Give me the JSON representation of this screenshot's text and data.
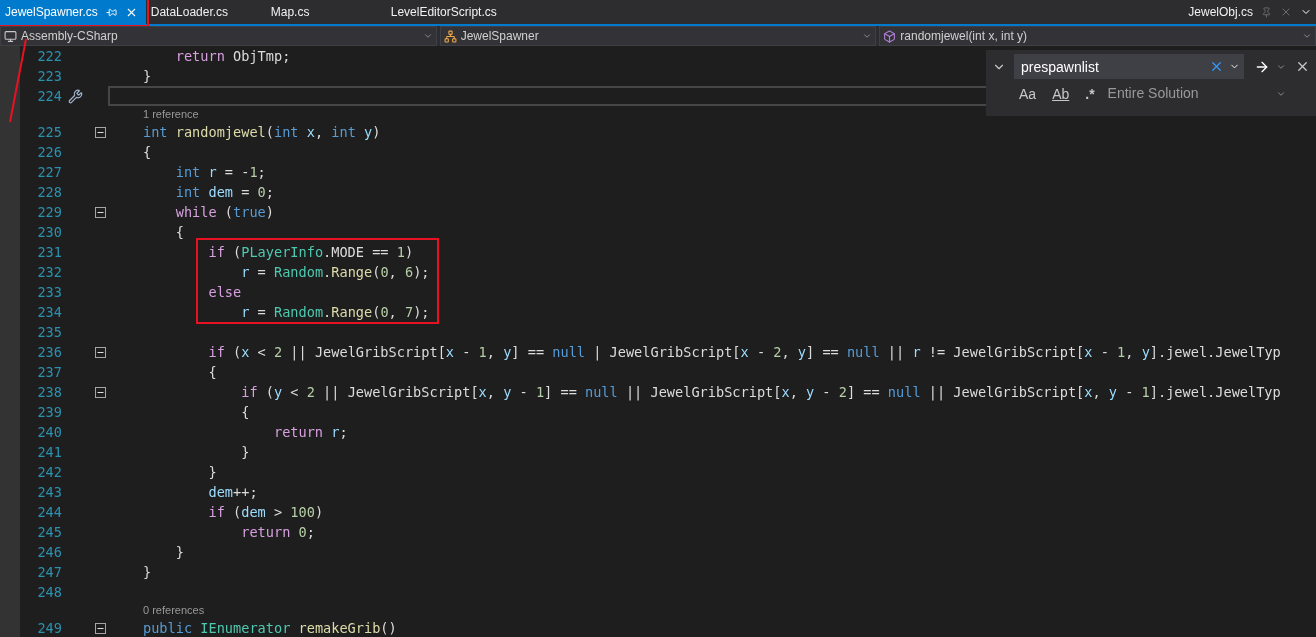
{
  "tabs": [
    {
      "label": "JewelSpawner.cs",
      "selected": true,
      "highlighted": true,
      "pinned": true
    },
    {
      "label": "DataLoader.cs",
      "selected": false,
      "highlighted": false,
      "pinned": false
    },
    {
      "label": "Map.cs",
      "selected": false,
      "highlighted": false,
      "pinned": false
    },
    {
      "label": "LevelEditorScript.cs",
      "selected": false,
      "highlighted": false,
      "pinned": false
    }
  ],
  "preview_tab": {
    "label": "JewelObj.cs"
  },
  "navigation": [
    {
      "kind": "project",
      "label": "Assembly-CSharp"
    },
    {
      "kind": "class",
      "label": "JewelSpawner"
    },
    {
      "kind": "method",
      "label": "randomjewel(int x, int y)"
    }
  ],
  "find": {
    "value": "prespawnlist",
    "options": [
      {
        "label": "Aa",
        "selected": false
      },
      {
        "label": "Ab",
        "selected": false
      },
      {
        "label": ".*",
        "selected": false
      }
    ],
    "scope": "Entire Solution"
  },
  "lines": [
    {
      "kind": "code",
      "number": "222",
      "foldable": false,
      "current": false,
      "highlighted": false,
      "tokens": [
        {
          "kind": "control",
          "text": "    return"
        },
        {
          "kind": "plain",
          "text": " ObjTmp;"
        }
      ]
    },
    {
      "kind": "code",
      "number": "223",
      "foldable": false,
      "current": false,
      "highlighted": false,
      "tokens": [
        {
          "kind": "plain",
          "text": "}"
        }
      ]
    },
    {
      "kind": "code",
      "number": "224",
      "foldable": false,
      "current": true,
      "highlighted": false
    },
    {
      "kind": "lens",
      "text": "1 reference"
    },
    {
      "kind": "code",
      "number": "225",
      "foldable": true,
      "current": false,
      "highlighted": false,
      "tokens": [
        {
          "kind": "keyword",
          "text": "int"
        },
        {
          "kind": "method",
          "text": " randomjewel"
        },
        {
          "kind": "plain",
          "text": "("
        },
        {
          "kind": "keyword",
          "text": "int"
        },
        {
          "kind": "variable",
          "text": " x"
        },
        {
          "kind": "plain",
          "text": ", "
        },
        {
          "kind": "keyword",
          "text": "int"
        },
        {
          "kind": "variable",
          "text": " y"
        },
        {
          "kind": "plain",
          "text": ")"
        }
      ]
    },
    {
      "kind": "code",
      "number": "226",
      "foldable": false,
      "current": false,
      "highlighted": false,
      "tokens": [
        {
          "kind": "plain",
          "text": "{"
        }
      ]
    },
    {
      "kind": "code",
      "number": "227",
      "foldable": false,
      "current": false,
      "highlighted": false,
      "tokens": [
        {
          "kind": "keyword",
          "text": "    int"
        },
        {
          "kind": "variable",
          "text": " r"
        },
        {
          "kind": "plain",
          "text": " = -"
        },
        {
          "kind": "number",
          "text": "1"
        },
        {
          "kind": "plain",
          "text": ";"
        }
      ]
    },
    {
      "kind": "code",
      "number": "228",
      "foldable": false,
      "current": false,
      "highlighted": false,
      "tokens": [
        {
          "kind": "keyword",
          "text": "    int"
        },
        {
          "kind": "variable",
          "text": " dem"
        },
        {
          "kind": "plain",
          "text": " = "
        },
        {
          "kind": "number",
          "text": "0"
        },
        {
          "kind": "plain",
          "text": ";"
        }
      ]
    },
    {
      "kind": "code",
      "number": "229",
      "foldable": true,
      "current": false,
      "highlighted": false,
      "tokens": [
        {
          "kind": "control",
          "text": "    while"
        },
        {
          "kind": "plain",
          "text": " ("
        },
        {
          "kind": "keyword",
          "text": "true"
        },
        {
          "kind": "plain",
          "text": ")"
        }
      ]
    },
    {
      "kind": "code",
      "number": "230",
      "foldable": false,
      "current": false,
      "highlighted": false,
      "tokens": [
        {
          "kind": "plain",
          "text": "    {"
        }
      ]
    },
    {
      "kind": "code",
      "number": "231",
      "foldable": false,
      "current": false,
      "highlighted": true,
      "tokens": [
        {
          "kind": "control",
          "text": "        if"
        },
        {
          "kind": "plain",
          "text": " ("
        },
        {
          "kind": "type",
          "text": "PLayerInfo"
        },
        {
          "kind": "plain",
          "text": ".MODE == "
        },
        {
          "kind": "number",
          "text": "1"
        },
        {
          "kind": "plain",
          "text": ")"
        }
      ]
    },
    {
      "kind": "code",
      "number": "232",
      "foldable": false,
      "current": false,
      "highlighted": true,
      "tokens": [
        {
          "kind": "variable",
          "text": "            r"
        },
        {
          "kind": "plain",
          "text": " = "
        },
        {
          "kind": "type",
          "text": "Random"
        },
        {
          "kind": "plain",
          "text": "."
        },
        {
          "kind": "method",
          "text": "Range"
        },
        {
          "kind": "plain",
          "text": "("
        },
        {
          "kind": "number",
          "text": "0"
        },
        {
          "kind": "plain",
          "text": ", "
        },
        {
          "kind": "number",
          "text": "6"
        },
        {
          "kind": "plain",
          "text": ");"
        }
      ]
    },
    {
      "kind": "code",
      "number": "233",
      "foldable": false,
      "current": false,
      "highlighted": true,
      "tokens": [
        {
          "kind": "control",
          "text": "        else"
        }
      ]
    },
    {
      "kind": "code",
      "number": "234",
      "foldable": false,
      "current": false,
      "highlighted": true,
      "tokens": [
        {
          "kind": "variable",
          "text": "            r"
        },
        {
          "kind": "plain",
          "text": " = "
        },
        {
          "kind": "type",
          "text": "Random"
        },
        {
          "kind": "plain",
          "text": "."
        },
        {
          "kind": "method",
          "text": "Range"
        },
        {
          "kind": "plain",
          "text": "("
        },
        {
          "kind": "number",
          "text": "0"
        },
        {
          "kind": "plain",
          "text": ", "
        },
        {
          "kind": "number",
          "text": "7"
        },
        {
          "kind": "plain",
          "text": ");"
        }
      ]
    },
    {
      "kind": "code",
      "number": "235",
      "foldable": false,
      "current": false,
      "highlighted": false
    },
    {
      "kind": "code",
      "number": "236",
      "foldable": true,
      "current": false,
      "highlighted": false,
      "tokens": [
        {
          "kind": "control",
          "text": "        if"
        },
        {
          "kind": "plain",
          "text": " ("
        },
        {
          "kind": "variable",
          "text": "x"
        },
        {
          "kind": "plain",
          "text": " < "
        },
        {
          "kind": "number",
          "text": "2"
        },
        {
          "kind": "plain",
          "text": " || JewelGribScript["
        },
        {
          "kind": "variable",
          "text": "x"
        },
        {
          "kind": "plain",
          "text": " - "
        },
        {
          "kind": "number",
          "text": "1"
        },
        {
          "kind": "plain",
          "text": ", "
        },
        {
          "kind": "variable",
          "text": "y"
        },
        {
          "kind": "plain",
          "text": "] == "
        },
        {
          "kind": "keyword",
          "text": "null"
        },
        {
          "kind": "plain",
          "text": " | JewelGribScript["
        },
        {
          "kind": "variable",
          "text": "x"
        },
        {
          "kind": "plain",
          "text": " - "
        },
        {
          "kind": "number",
          "text": "2"
        },
        {
          "kind": "plain",
          "text": ", "
        },
        {
          "kind": "variable",
          "text": "y"
        },
        {
          "kind": "plain",
          "text": "] == "
        },
        {
          "kind": "keyword",
          "text": "null"
        },
        {
          "kind": "plain",
          "text": " || "
        },
        {
          "kind": "variable",
          "text": "r"
        },
        {
          "kind": "plain",
          "text": " != JewelGribScript["
        },
        {
          "kind": "variable",
          "text": "x"
        },
        {
          "kind": "plain",
          "text": " - "
        },
        {
          "kind": "number",
          "text": "1"
        },
        {
          "kind": "plain",
          "text": ", "
        },
        {
          "kind": "variable",
          "text": "y"
        },
        {
          "kind": "plain",
          "text": "].jewel.JewelTyp"
        }
      ]
    },
    {
      "kind": "code",
      "number": "237",
      "foldable": false,
      "current": false,
      "highlighted": false,
      "tokens": [
        {
          "kind": "plain",
          "text": "        {"
        }
      ]
    },
    {
      "kind": "code",
      "number": "238",
      "foldable": true,
      "current": false,
      "highlighted": false,
      "tokens": [
        {
          "kind": "control",
          "text": "            if"
        },
        {
          "kind": "plain",
          "text": " ("
        },
        {
          "kind": "variable",
          "text": "y"
        },
        {
          "kind": "plain",
          "text": " < "
        },
        {
          "kind": "number",
          "text": "2"
        },
        {
          "kind": "plain",
          "text": " || JewelGribScript["
        },
        {
          "kind": "variable",
          "text": "x"
        },
        {
          "kind": "plain",
          "text": ", "
        },
        {
          "kind": "variable",
          "text": "y"
        },
        {
          "kind": "plain",
          "text": " - "
        },
        {
          "kind": "number",
          "text": "1"
        },
        {
          "kind": "plain",
          "text": "] == "
        },
        {
          "kind": "keyword",
          "text": "null"
        },
        {
          "kind": "plain",
          "text": " || JewelGribScript["
        },
        {
          "kind": "variable",
          "text": "x"
        },
        {
          "kind": "plain",
          "text": ", "
        },
        {
          "kind": "variable",
          "text": "y"
        },
        {
          "kind": "plain",
          "text": " - "
        },
        {
          "kind": "number",
          "text": "2"
        },
        {
          "kind": "plain",
          "text": "] == "
        },
        {
          "kind": "keyword",
          "text": "null"
        },
        {
          "kind": "plain",
          "text": " || JewelGribScript["
        },
        {
          "kind": "variable",
          "text": "x"
        },
        {
          "kind": "plain",
          "text": ", "
        },
        {
          "kind": "variable",
          "text": "y"
        },
        {
          "kind": "plain",
          "text": " - "
        },
        {
          "kind": "number",
          "text": "1"
        },
        {
          "kind": "plain",
          "text": "].jewel.JewelTyp"
        }
      ]
    },
    {
      "kind": "code",
      "number": "239",
      "foldable": false,
      "current": false,
      "highlighted": false,
      "tokens": [
        {
          "kind": "plain",
          "text": "            {"
        }
      ]
    },
    {
      "kind": "code",
      "number": "240",
      "foldable": false,
      "current": false,
      "highlighted": false,
      "tokens": [
        {
          "kind": "control",
          "text": "                return"
        },
        {
          "kind": "variable",
          "text": " r"
        },
        {
          "kind": "plain",
          "text": ";"
        }
      ]
    },
    {
      "kind": "code",
      "number": "241",
      "foldable": false,
      "current": false,
      "highlighted": false,
      "tokens": [
        {
          "kind": "plain",
          "text": "            }"
        }
      ]
    },
    {
      "kind": "code",
      "number": "242",
      "foldable": false,
      "current": false,
      "highlighted": false,
      "tokens": [
        {
          "kind": "plain",
          "text": "        }"
        }
      ]
    },
    {
      "kind": "code",
      "number": "243",
      "foldable": false,
      "current": false,
      "highlighted": false,
      "tokens": [
        {
          "kind": "variable",
          "text": "        dem"
        },
        {
          "kind": "plain",
          "text": "++;"
        }
      ]
    },
    {
      "kind": "code",
      "number": "244",
      "foldable": false,
      "current": false,
      "highlighted": false,
      "tokens": [
        {
          "kind": "control",
          "text": "        if"
        },
        {
          "kind": "plain",
          "text": " ("
        },
        {
          "kind": "variable",
          "text": "dem"
        },
        {
          "kind": "plain",
          "text": " > "
        },
        {
          "kind": "number",
          "text": "100"
        },
        {
          "kind": "plain",
          "text": ")"
        }
      ]
    },
    {
      "kind": "code",
      "number": "245",
      "foldable": false,
      "current": false,
      "highlighted": false,
      "tokens": [
        {
          "kind": "control",
          "text": "            return"
        },
        {
          "kind": "number",
          "text": " 0"
        },
        {
          "kind": "plain",
          "text": ";"
        }
      ]
    },
    {
      "kind": "code",
      "number": "246",
      "foldable": false,
      "current": false,
      "highlighted": false,
      "tokens": [
        {
          "kind": "plain",
          "text": "    }"
        }
      ]
    },
    {
      "kind": "code",
      "number": "247",
      "foldable": false,
      "current": false,
      "highlighted": false,
      "tokens": [
        {
          "kind": "plain",
          "text": "}"
        }
      ]
    },
    {
      "kind": "code",
      "number": "248",
      "foldable": false,
      "current": false,
      "highlighted": false
    },
    {
      "kind": "lens",
      "text": "0 references"
    },
    {
      "kind": "code",
      "number": "249",
      "foldable": true,
      "current": false,
      "highlighted": false,
      "tokens": [
        {
          "kind": "keyword",
          "text": "public"
        },
        {
          "kind": "type",
          "text": " IEnumerator"
        },
        {
          "kind": "method",
          "text": " remakeGrib"
        },
        {
          "kind": "plain",
          "text": "()"
        }
      ]
    }
  ]
}
